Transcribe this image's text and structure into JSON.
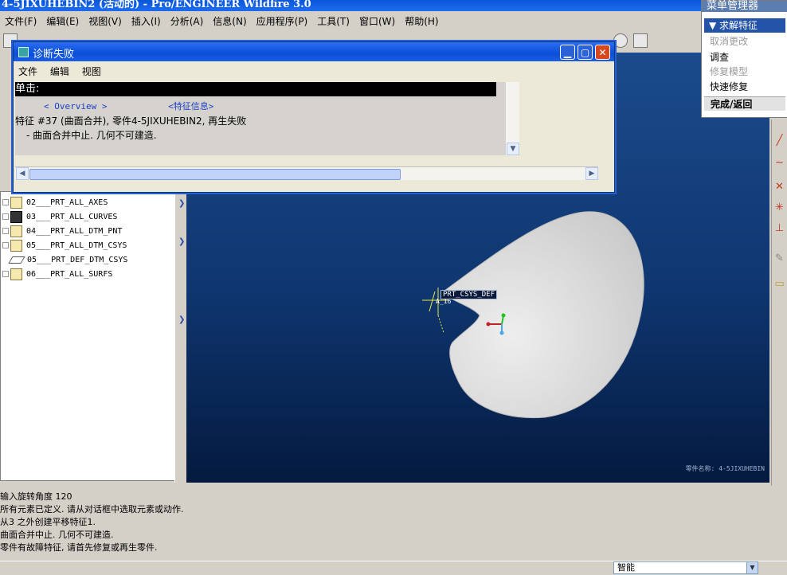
{
  "window": {
    "title": "4-5JIXUHEBIN2 (活动的) - Pro/ENGINEER Wildfire 3.0"
  },
  "menubar": [
    "文件(F)",
    "编辑(E)",
    "视图(V)",
    "插入(I)",
    "分析(A)",
    "信息(N)",
    "应用程序(P)",
    "工具(T)",
    "窗口(W)",
    "帮助(H)"
  ],
  "menu_manager": {
    "title": "菜单管理器",
    "active_item": "求解特征",
    "items": [
      {
        "label": "取消更改",
        "enabled": false
      },
      {
        "label": "调查",
        "enabled": true
      },
      {
        "label": "修复模型",
        "enabled": false
      },
      {
        "label": "快速修复",
        "enabled": true
      }
    ],
    "done": "完成/返回"
  },
  "dialog": {
    "title": "诊断失败",
    "menu": [
      "文件",
      "编辑",
      "视图"
    ],
    "click_row": "单击:",
    "links": [
      "< Overview >",
      "<特征信息>"
    ],
    "message_line1": "特征 #37 (曲面合并), 零件4-5JIXUHEBIN2, 再生失败",
    "message_line2": "- 曲面合并中止. 几何不可建造."
  },
  "model_tree": {
    "items": [
      {
        "name": "02___PRT_ALL_AXES",
        "icon": "layer-icon"
      },
      {
        "name": "03___PRT_ALL_CURVES",
        "icon": "layer-icon-dark"
      },
      {
        "name": "04___PRT_ALL_DTM_PNT",
        "icon": "layer-icon"
      },
      {
        "name": "05___PRT_ALL_DTM_CSYS",
        "icon": "layer-icon"
      },
      {
        "name": "05___PRT_DEF_DTM_CSYS",
        "icon": "plane-icon"
      },
      {
        "name": "06___PRT_ALL_SURFS",
        "icon": "layer-icon"
      }
    ]
  },
  "viewport": {
    "csys_label": "PRT_CSYS_DEF",
    "axis_label": "A_16",
    "watermark": "零件名称: 4-5JIXUHEBIN"
  },
  "messages": [
    "输入旋转角度    120",
    "所有元素已定义. 请从对话框中选取元素或动作.",
    "从3 之外创建平移特征1.",
    "曲面合并中止. 几何不可建造.",
    "零件有故障特征, 请首先修复或再生零件."
  ],
  "status": {
    "filter_value": "智能"
  },
  "colors": {
    "title_blue": "#0a56d8",
    "viewport_top": "#1b4b8c",
    "viewport_bottom": "#041a3f",
    "highlight": "#2353a8"
  }
}
